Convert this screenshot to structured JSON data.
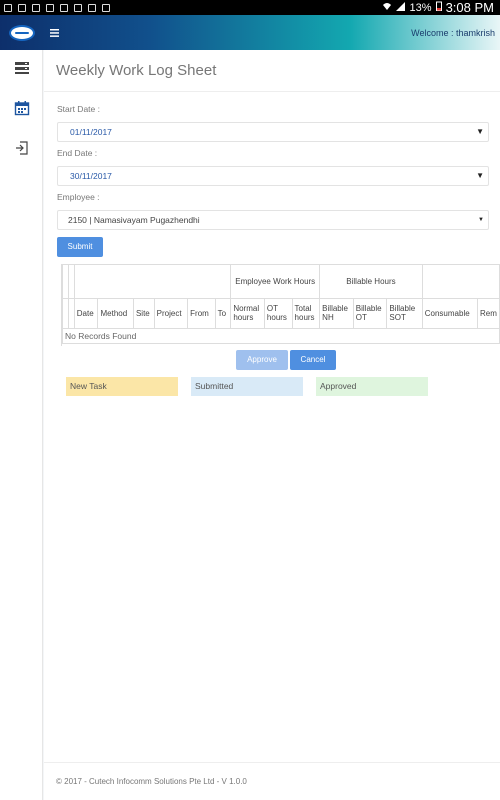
{
  "status_bar": {
    "battery": "13%",
    "time": "3:08 PM"
  },
  "header": {
    "welcome_label": "Welcome :",
    "username": "thamkrish"
  },
  "page": {
    "title": "Weekly Work Log Sheet"
  },
  "form": {
    "start_date_label": "Start Date :",
    "start_date_value": "01/11/2017",
    "end_date_label": "End Date :",
    "end_date_value": "30/11/2017",
    "employee_label": "Employee :",
    "employee_value": "2150 | Namasivayam Pugazhendhi",
    "submit_label": "Submit"
  },
  "table": {
    "group_headers": {
      "work_hours": "Employee Work Hours",
      "billable": "Billable Hours"
    },
    "columns": [
      "Date",
      "Method",
      "Site",
      "Project",
      "From",
      "To",
      "Normal hours",
      "OT hours",
      "Total hours",
      "Billable NH",
      "Billable OT",
      "Billable SOT",
      "Consumable",
      "Rem"
    ],
    "empty_text": "No Records Found"
  },
  "actions": {
    "approve_label": "Approve",
    "cancel_label": "Cancel"
  },
  "legend": {
    "new_task": "New Task",
    "submitted": "Submitted",
    "approved": "Approved"
  },
  "footer": {
    "text": "© 2017 - Cutech Infocomm Solutions Pte Ltd - V 1.0.0"
  },
  "colors": {
    "primary_button": "#4f8fe0",
    "new_task": "#fbe6a7",
    "submitted": "#d9eaf7",
    "approved": "#dff5de"
  }
}
